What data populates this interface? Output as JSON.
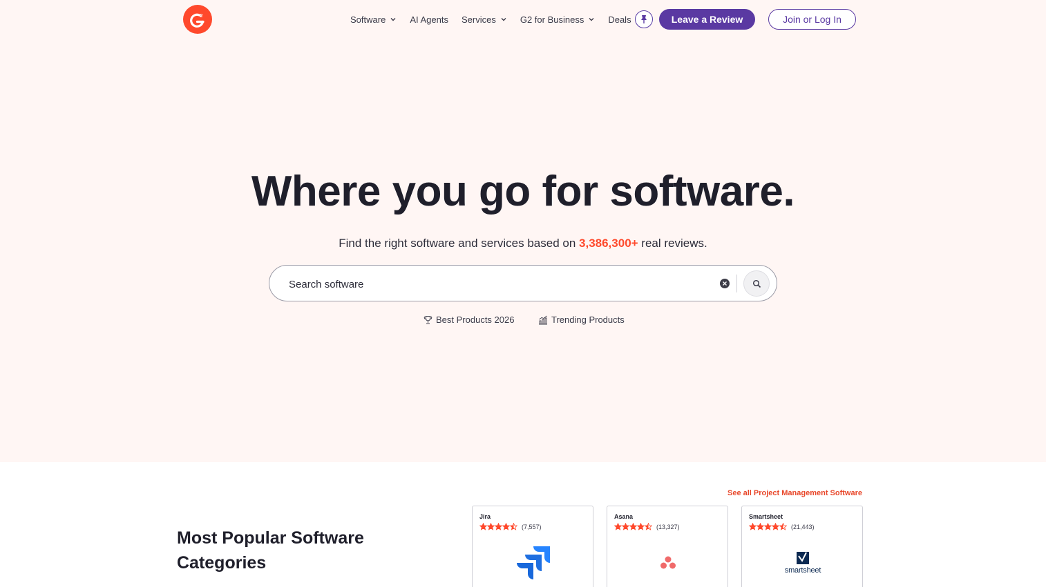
{
  "brand": {
    "logo_icon": "g2-logo-icon",
    "accent": "#ff492c",
    "primary": "#5a39a2"
  },
  "nav": {
    "items": [
      {
        "label": "Software",
        "dropdown": true
      },
      {
        "label": "AI Agents",
        "dropdown": false
      },
      {
        "label": "Services",
        "dropdown": true
      },
      {
        "label": "G2 for Business",
        "dropdown": true
      },
      {
        "label": "Deals",
        "dropdown": false
      }
    ],
    "pin_icon": "pushpin-icon",
    "review_label": "Leave a Review",
    "login_label": "Join or Log In"
  },
  "hero": {
    "headline": "Where you go for software.",
    "sub_prefix": "Find the right software and services based on ",
    "review_count": "3,386,300+",
    "sub_suffix": " real reviews.",
    "search_placeholder": "Search software",
    "quick_links": [
      {
        "icon": "trophy-icon",
        "label": "Best Products 2026"
      },
      {
        "icon": "trending-chart-icon",
        "label": "Trending Products"
      }
    ]
  },
  "popular": {
    "title": "Most Popular Software Categories",
    "see_all": "See all Project Management Software",
    "cards": [
      {
        "name": "Jira",
        "rating": 4.5,
        "count": "(7,557)",
        "logo_icon": "jira-logo-icon"
      },
      {
        "name": "Asana",
        "rating": 4.5,
        "count": "(13,327)",
        "logo_icon": "asana-logo-icon"
      },
      {
        "name": "Smartsheet",
        "rating": 4.5,
        "count": "(21,443)",
        "logo_icon": "smartsheet-logo-icon",
        "logo_text": "smartsheet"
      }
    ]
  }
}
